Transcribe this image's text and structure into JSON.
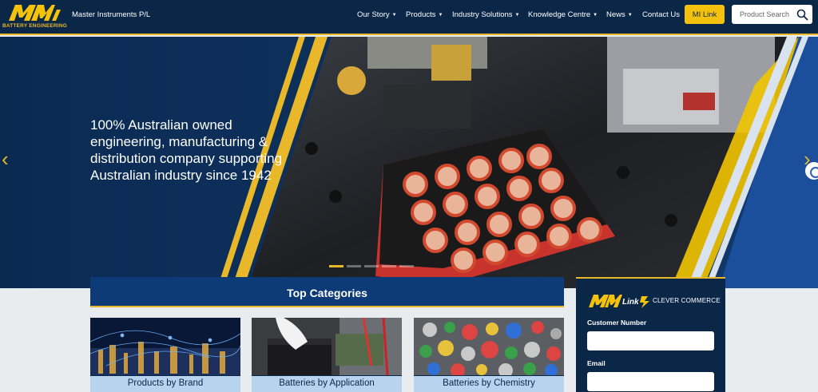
{
  "header": {
    "logo_text": "BATTERY ENGINEERING",
    "company": "Master Instruments P/L",
    "nav": [
      {
        "label": "Our Story",
        "dropdown": true
      },
      {
        "label": "Products",
        "dropdown": true
      },
      {
        "label": "Industry Solutions",
        "dropdown": true
      },
      {
        "label": "Knowledge Centre",
        "dropdown": true
      },
      {
        "label": "News",
        "dropdown": true
      },
      {
        "label": "Contact Us",
        "dropdown": false
      }
    ],
    "milink_button": "MI Link",
    "search_placeholder": "Product Search",
    "search_icon": "search-icon"
  },
  "hero": {
    "headline": "100% Australian owned engineering, manufacturing & distribution company supporting Australian industry since 1942",
    "prev_icon": "chevron-left-icon",
    "next_icon": "chevron-right-icon",
    "slides_total": 5,
    "slide_active": 1
  },
  "categories": {
    "title": "Top Categories",
    "items": [
      {
        "label": "Products by Brand"
      },
      {
        "label": "Batteries by Application"
      },
      {
        "label": "Batteries by Chemistry"
      }
    ]
  },
  "milink_panel": {
    "tagline": "CLEVER COMMERCE",
    "customer_number_label": "Customer Number",
    "email_label": "Email",
    "customer_number_value": "",
    "email_value": ""
  },
  "colors": {
    "navy": "#0b2748",
    "accent_yellow": "#f4c20d",
    "category_blue": "#0d3b78",
    "label_bg": "#b8d3ee"
  }
}
